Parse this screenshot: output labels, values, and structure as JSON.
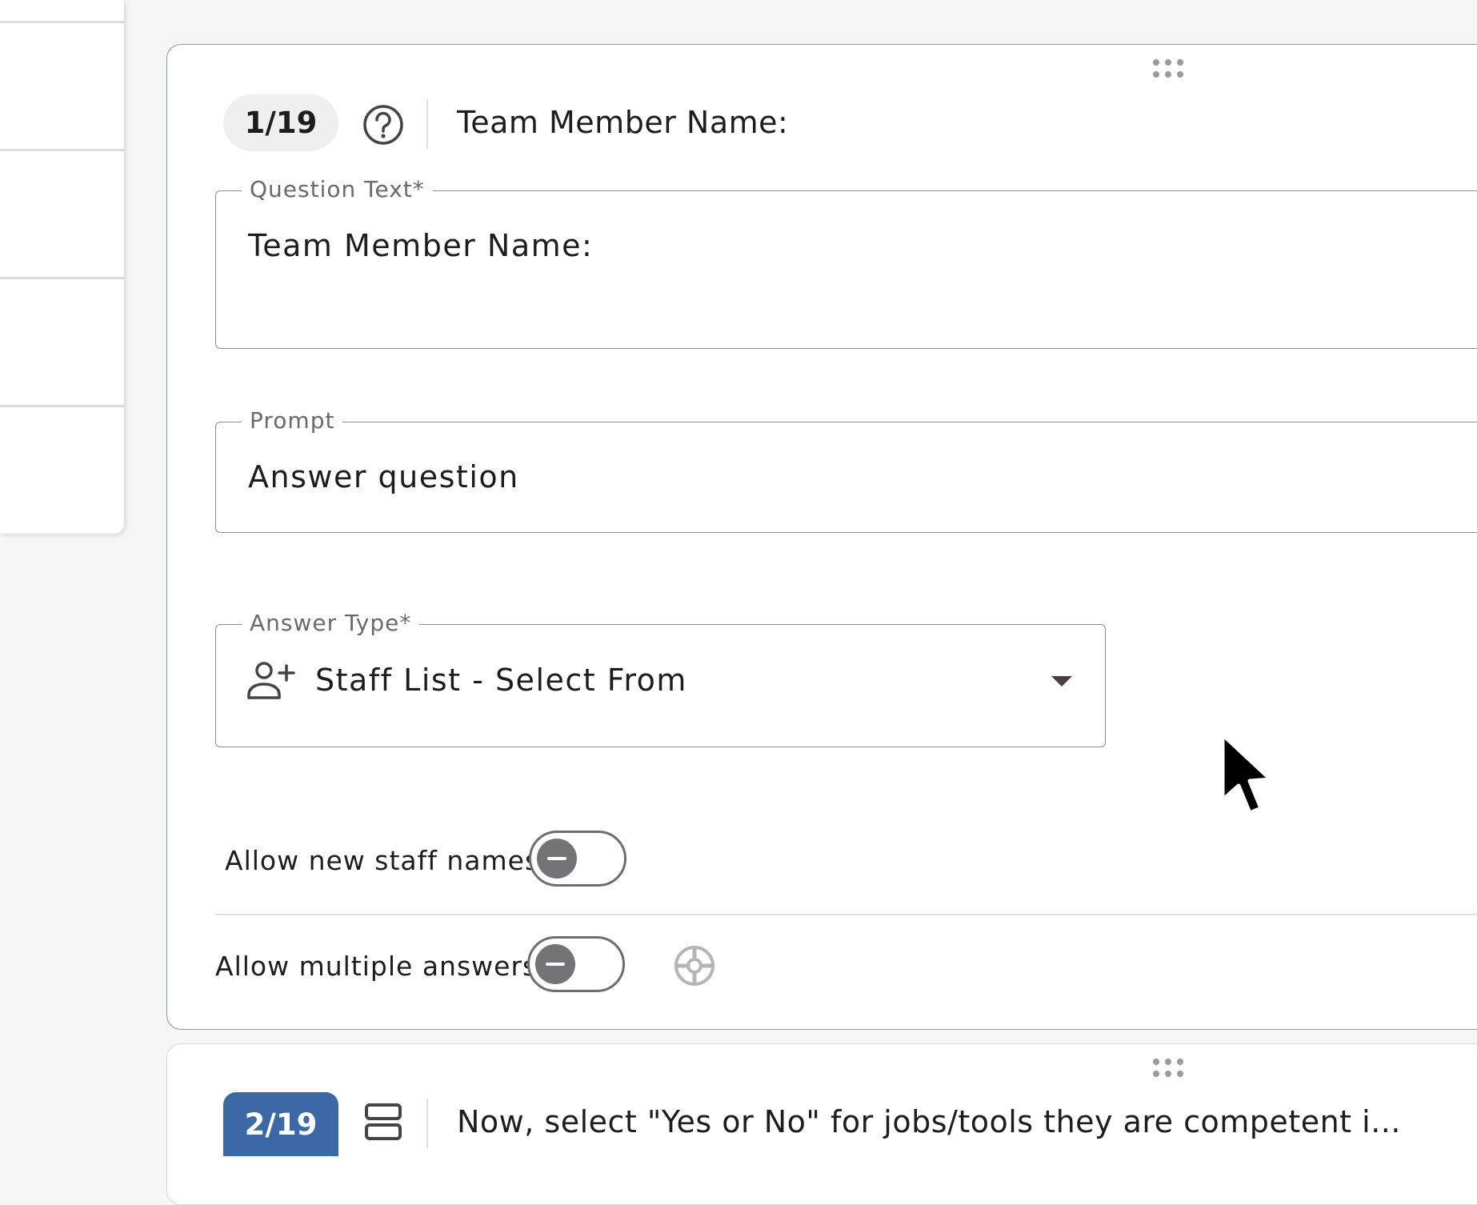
{
  "question1": {
    "counter": "1/19",
    "title": "Team Member Name:",
    "question_text": {
      "label": "Question Text*",
      "value": "Team Member Name:"
    },
    "prompt": {
      "label": "Prompt",
      "value": "Answer question"
    },
    "answer_type": {
      "label": "Answer Type*",
      "value": "Staff List - Select From",
      "icon": "person-add-icon"
    },
    "toggles": [
      {
        "label": "Allow new staff names",
        "checked": false
      },
      {
        "label": "Allow multiple answers",
        "checked": false
      }
    ],
    "settings_icon": "settings-icon"
  },
  "question2": {
    "counter": "2/19",
    "title": "Now, select \"Yes or No\" for jobs/tools they are competent i...",
    "icon": "stack-icon"
  }
}
